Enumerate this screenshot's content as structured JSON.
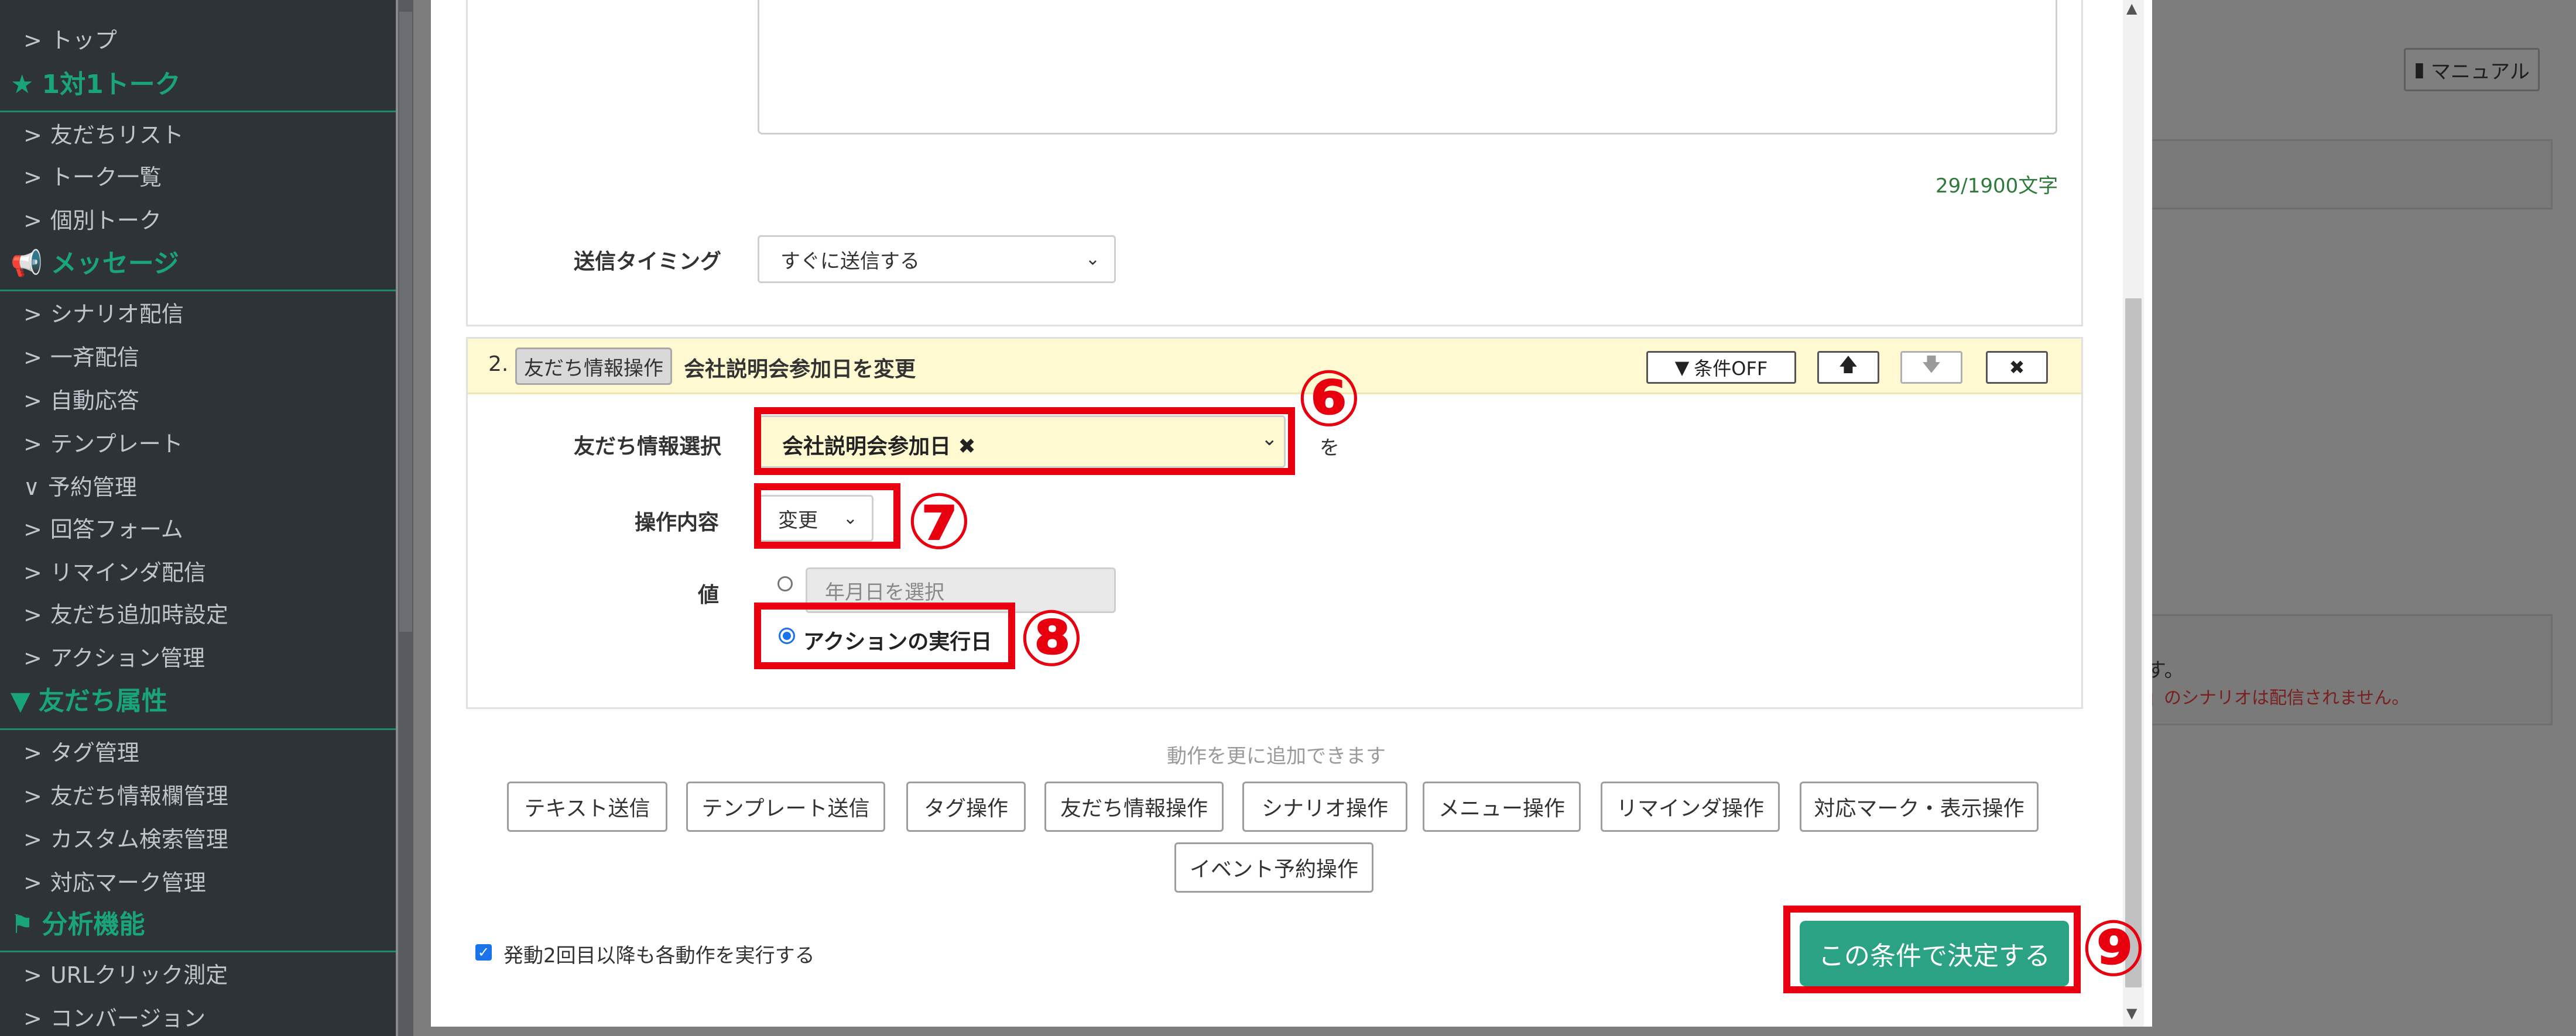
{
  "sidebar": {
    "items": [
      {
        "label": "トップ",
        "chevron": ">"
      },
      {
        "label": "友だちリスト",
        "chevron": ">"
      },
      {
        "label": "トーク一覧",
        "chevron": ">"
      },
      {
        "label": "個別トーク",
        "chevron": ">"
      },
      {
        "label": "シナリオ配信",
        "chevron": ">"
      },
      {
        "label": "一斉配信",
        "chevron": ">"
      },
      {
        "label": "自動応答",
        "chevron": ">"
      },
      {
        "label": "テンプレート",
        "chevron": ">"
      },
      {
        "label": "予約管理",
        "chevron": "∨"
      },
      {
        "label": "回答フォーム",
        "chevron": ">"
      },
      {
        "label": "リマインダ配信",
        "chevron": ">"
      },
      {
        "label": "友だち追加時設定",
        "chevron": ">"
      },
      {
        "label": "アクション管理",
        "chevron": ">"
      },
      {
        "label": "タグ管理",
        "chevron": ">"
      },
      {
        "label": "友だち情報欄管理",
        "chevron": ">"
      },
      {
        "label": "カスタム検索管理",
        "chevron": ">"
      },
      {
        "label": "対応マーク管理",
        "chevron": ">"
      },
      {
        "label": "URLクリック測定",
        "chevron": ">"
      },
      {
        "label": "コンバージョン",
        "chevron": ">"
      }
    ],
    "sections": [
      {
        "label": "1対1トーク",
        "icon": "★"
      },
      {
        "label": "メッセージ",
        "icon": "📢"
      },
      {
        "label": "友だち属性",
        "icon": "▼"
      },
      {
        "label": "分析機能",
        "icon": "⚑"
      }
    ]
  },
  "background": {
    "manual_label": "マニュアル",
    "text1": "す。",
    "text2": "」のシナリオは配信されません。"
  },
  "modal": {
    "char_count": "29/1900文字",
    "timing_label": "送信タイミング",
    "timing_value": "すぐに送信する",
    "action2": {
      "number": "2.",
      "type": "友だち情報操作",
      "title": "会社説明会参加日を変更",
      "cond_button": "条件OFF",
      "up_icon": "🡅",
      "down_icon": "🡇",
      "close_icon": "✖"
    },
    "friend_info_label": "友だち情報選択",
    "friend_info_value": "会社説明会参加日 ✖",
    "wo": "を",
    "operation_label": "操作内容",
    "operation_value": "変更",
    "value_label": "値",
    "date_placeholder": "年月日を選択",
    "radio_action_date": "アクションの実行日",
    "add_hint": "動作を更に追加できます",
    "add_buttons": [
      "テキスト送信",
      "テンプレート送信",
      "タグ操作",
      "友だち情報操作",
      "シナリオ操作",
      "メニュー操作",
      "リマインダ操作",
      "対応マーク・表示操作",
      "イベント予約操作"
    ],
    "repeat_label": "発動2回目以降も各動作を実行する",
    "submit_label": "この条件で決定する"
  },
  "annotations": {
    "step6": "⑥",
    "step7": "⑦",
    "step8": "⑧",
    "step9": "⑨",
    "color": "#e8000f"
  },
  "colors": {
    "sidebar_bg": "#2e3338",
    "sidebar_accent": "#1aa579",
    "submit": "#2aa283",
    "panel_head": "#fff9d2"
  }
}
